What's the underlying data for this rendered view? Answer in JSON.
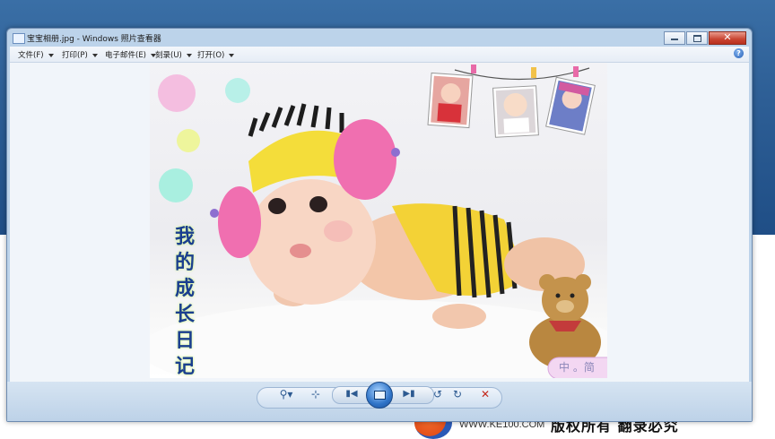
{
  "window": {
    "title": "宝宝相册.jpg - Windows 照片查看器"
  },
  "menu": [
    {
      "label": "文件(F)"
    },
    {
      "label": "打印(P)"
    },
    {
      "label": "电子邮件(E)"
    },
    {
      "label": "刻录(U)"
    },
    {
      "label": "打开(O)"
    }
  ],
  "help_glyph": "?",
  "photo": {
    "vertical_text": [
      "我",
      "的",
      "成",
      "长",
      "日",
      "记"
    ],
    "badge_text": "中 。简"
  },
  "toolbar": {
    "zoom": "zoom-icon",
    "fit": "actual-size-icon",
    "prev": "previous-icon",
    "slideshow": "slideshow-icon",
    "next": "next-icon",
    "rotate_ccw": "rotate-counterclockwise-icon",
    "rotate_cw": "rotate-clockwise-icon",
    "delete": "delete-icon"
  },
  "watermark": {
    "url": "WWW.KE100.COM",
    "copyright": "版权所有 翻录必究"
  },
  "colors": {
    "desktop": "#2e5f96",
    "window_frame": "#bcd3ea",
    "close_button": "#c94431",
    "vertical_text": "#1a3e8f",
    "hat": "#f4dd3a",
    "earmuff": "#f06fb0"
  }
}
